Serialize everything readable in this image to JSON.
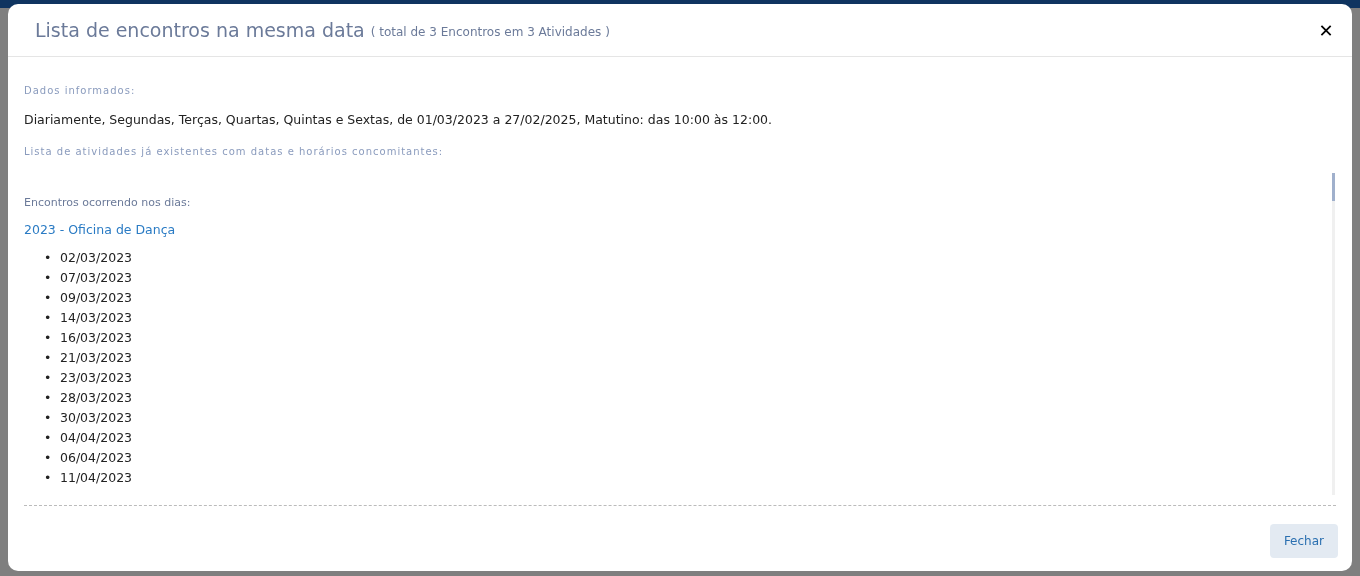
{
  "modal": {
    "title": "Lista de encontros na mesma data",
    "subtitle": "( total de 3 Encontros em 3 Atividades )",
    "close": "✕"
  },
  "informed_label": "Dados informados:",
  "informed_text": "Diariamente, Segundas, Terças, Quartas, Quintas e Sextas, de 01/03/2023 a 27/02/2025, Matutino: das 10:00 às 12:00.",
  "list_label": "Lista de atividades já existentes com datas e horários concomitantes:",
  "occurrences_label": "Encontros ocorrendo nos dias:",
  "activity": "2023 - Oficina de Dança",
  "bullet": "•",
  "dates": [
    "02/03/2023",
    "07/03/2023",
    "09/03/2023",
    "14/03/2023",
    "16/03/2023",
    "21/03/2023",
    "23/03/2023",
    "28/03/2023",
    "30/03/2023",
    "04/04/2023",
    "06/04/2023",
    "11/04/2023"
  ],
  "buttons": [
    "Fechar"
  ]
}
